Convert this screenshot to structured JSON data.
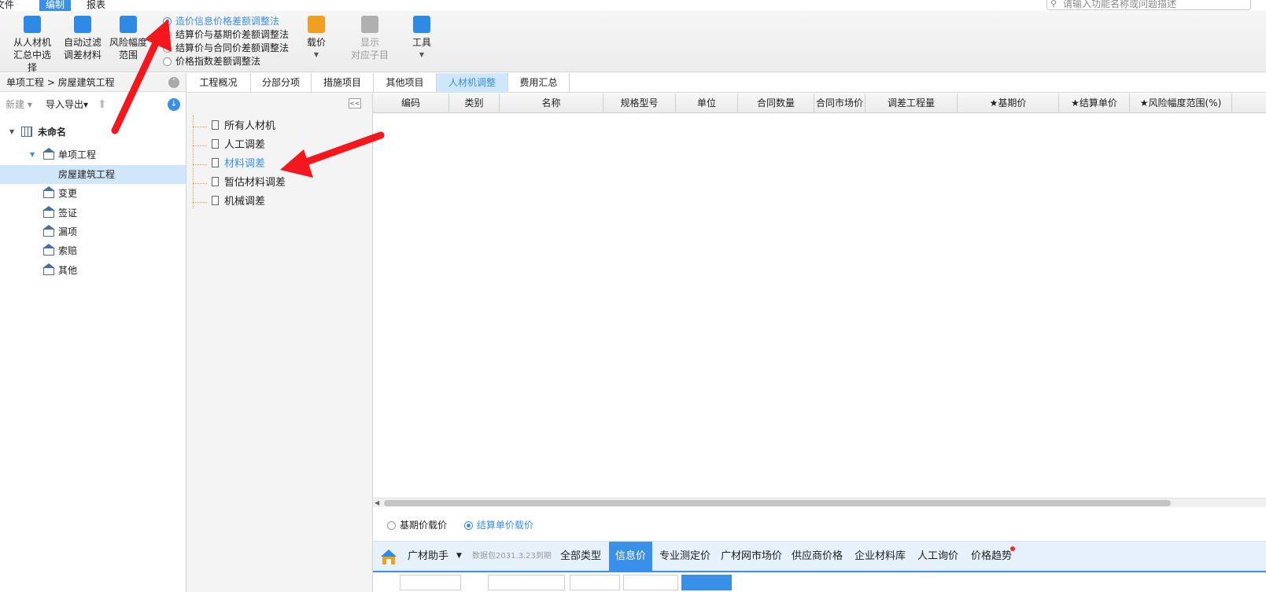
{
  "menubar": {
    "items": [
      "文件",
      "编制",
      "报表"
    ],
    "active_index": 1,
    "search_placeholder": "请输入功能名称或问题描述"
  },
  "ribbon": {
    "buttons": [
      {
        "line1": "从人材机",
        "line2": "汇总中选择",
        "icon": "select-from-summary-icon"
      },
      {
        "line1": "自动过滤",
        "line2": "调差材料",
        "icon": "auto-filter-icon"
      },
      {
        "line1": "风险幅度",
        "line2": "范围",
        "icon": "risk-range-icon"
      }
    ],
    "method_options": [
      "造价信息价格差额调整法",
      "结算价与基期价差额调整法",
      "结算价与合同价差额调整法",
      "价格指数差额调整法"
    ],
    "method_selected": 0,
    "price_button": "载价",
    "show_sub_line1": "显示",
    "show_sub_line2": "对应子目",
    "tools_button": "工具"
  },
  "left_panel": {
    "breadcrumb": "单项工程 > 房屋建筑工程",
    "new_label": "新建",
    "import_export_label": "导入导出",
    "tree": [
      {
        "label": "未命名",
        "level": 0,
        "icon": "building-icon",
        "expanded": true,
        "bold": true
      },
      {
        "label": "单项工程",
        "level": 1,
        "icon": "house-icon",
        "expanded": true
      },
      {
        "label": "房屋建筑工程",
        "level": 2,
        "icon": "none",
        "selected": true
      },
      {
        "label": "变更",
        "level": 1,
        "icon": "house-icon"
      },
      {
        "label": "签证",
        "level": 1,
        "icon": "house-icon"
      },
      {
        "label": "漏项",
        "level": 1,
        "icon": "house-icon"
      },
      {
        "label": "索赔",
        "level": 1,
        "icon": "house-icon"
      },
      {
        "label": "其他",
        "level": 1,
        "icon": "house-icon"
      }
    ]
  },
  "tabs": {
    "items": [
      "工程概况",
      "分部分项",
      "措施项目",
      "其他项目",
      "人材机调整",
      "费用汇总"
    ],
    "active_index": 4
  },
  "categories": {
    "items": [
      "所有人材机",
      "人工调差",
      "材料调差",
      "暂估材料调差",
      "机械调差"
    ],
    "active_index": 2
  },
  "grid": {
    "columns": [
      "编码",
      "类别",
      "名称",
      "规格型号",
      "单位",
      "合同数量",
      "合同市场价",
      "调差工程量",
      "★基期价",
      "★结算单价",
      "★风险幅度范围(%)"
    ]
  },
  "bottom": {
    "price_options": [
      "基期价载价",
      "结算单价载价"
    ],
    "price_selected": 1,
    "assistant_name": "广材助手",
    "data_package": "数据包2031.3.23到期",
    "tabs": [
      "全部类型",
      "信息价",
      "专业测定价",
      "广材网市场价",
      "供应商价格",
      "企业材料库",
      "人工询价",
      "价格趋势"
    ],
    "active_tab": 1
  },
  "colors": {
    "accent": "#3a8fe8",
    "selected_bg": "#cfe6fb",
    "arrow_red": "#f4171d"
  }
}
